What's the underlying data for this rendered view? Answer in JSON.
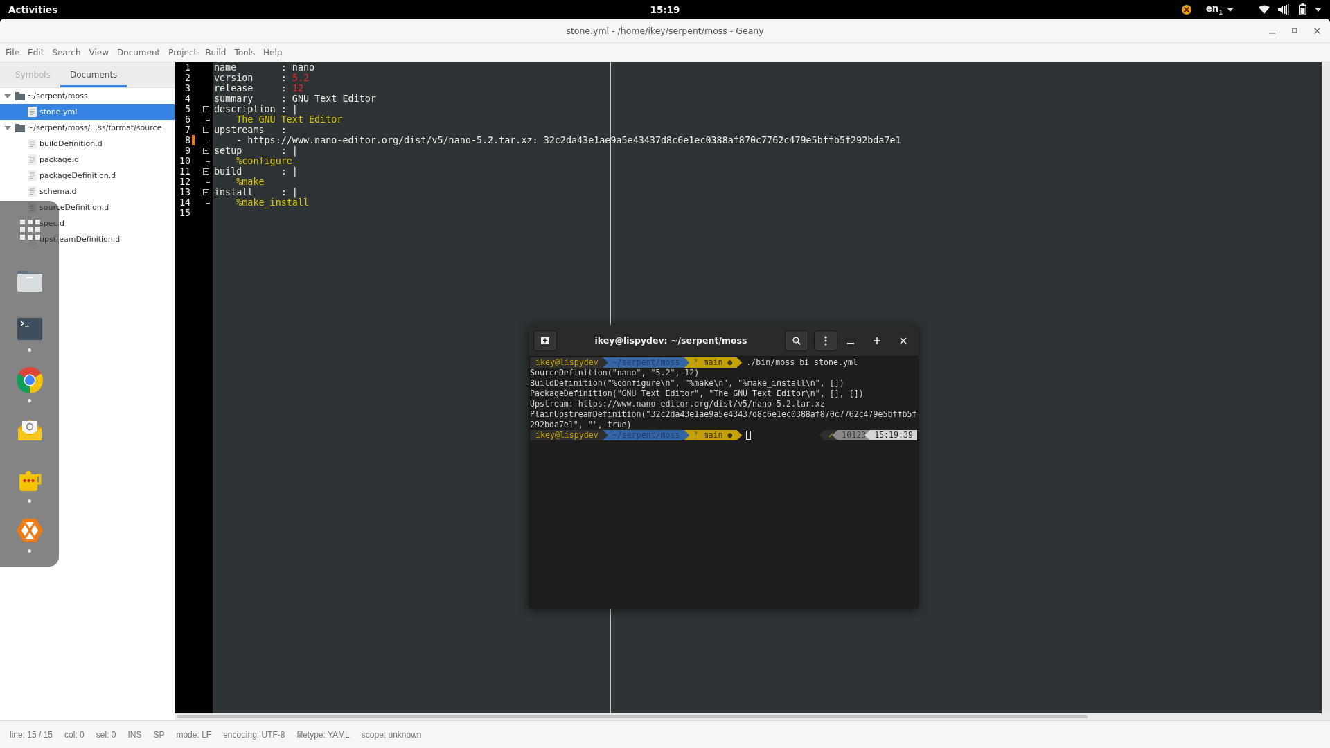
{
  "top_bar": {
    "activities": "Activities",
    "clock": "15:19",
    "keyboard": "en$_{1}$"
  },
  "window": {
    "title": "stone.yml - /home/ikey/serpent/moss - Geany"
  },
  "menu": [
    "File",
    "Edit",
    "Search",
    "View",
    "Document",
    "Project",
    "Build",
    "Tools",
    "Help"
  ],
  "sidebar": {
    "tabs": [
      {
        "label": "Symbols",
        "selected": false
      },
      {
        "label": "Documents",
        "selected": true
      }
    ],
    "tree": [
      {
        "kind": "folder",
        "label": "~/serpent/moss",
        "expanded": true,
        "selected": false,
        "children": [
          {
            "kind": "file",
            "label": "stone.yml",
            "selected": true
          }
        ]
      },
      {
        "kind": "folder",
        "label": "~/serpent/moss/…ss/format/source",
        "expanded": true,
        "selected": false,
        "children": [
          {
            "kind": "file",
            "label": "buildDefinition.d",
            "selected": false
          },
          {
            "kind": "file",
            "label": "package.d",
            "selected": false
          },
          {
            "kind": "file",
            "label": "packageDefinition.d",
            "selected": false
          },
          {
            "kind": "file",
            "label": "schema.d",
            "selected": false
          },
          {
            "kind": "file",
            "label": "sourceDefinition.d",
            "selected": false
          },
          {
            "kind": "file",
            "label": "spec.d",
            "selected": false
          },
          {
            "kind": "file",
            "label": "upstreamDefinition.d",
            "selected": false
          }
        ]
      }
    ]
  },
  "editor": {
    "lines": [
      {
        "number": "1",
        "fold_start": false,
        "fold_end": false,
        "modified": false,
        "tokens": [
          {
            "kind": "plain",
            "text": "name        : nano"
          }
        ]
      },
      {
        "number": "2",
        "fold_start": false,
        "fold_end": false,
        "modified": false,
        "tokens": [
          {
            "kind": "plain",
            "text": "version     : "
          },
          {
            "kind": "number",
            "text": "5.2"
          }
        ]
      },
      {
        "number": "3",
        "fold_start": false,
        "fold_end": false,
        "modified": false,
        "tokens": [
          {
            "kind": "plain",
            "text": "release     : "
          },
          {
            "kind": "number",
            "text": "12"
          }
        ]
      },
      {
        "number": "4",
        "fold_start": false,
        "fold_end": false,
        "modified": false,
        "tokens": [
          {
            "kind": "plain",
            "text": "summary     : GNU Text Editor"
          }
        ]
      },
      {
        "number": "5",
        "fold_start": true,
        "fold_end": false,
        "modified": false,
        "tokens": [
          {
            "kind": "plain",
            "text": "description : |"
          }
        ]
      },
      {
        "number": "6",
        "fold_start": false,
        "fold_end": true,
        "modified": false,
        "tokens": [
          {
            "kind": "string",
            "text": "    The GNU Text Editor"
          }
        ]
      },
      {
        "number": "7",
        "fold_start": true,
        "fold_end": false,
        "modified": false,
        "tokens": [
          {
            "kind": "plain",
            "text": "upstreams   :"
          }
        ]
      },
      {
        "number": "8",
        "fold_start": false,
        "fold_end": true,
        "modified": true,
        "tokens": [
          {
            "kind": "plain",
            "text": "    - https://www.nano-editor.org/dist/v5/nano-5.2.tar.xz: 32c2da43e1ae9a5e43437d8c6e1ec0388af870c7762c479e5bffb5f292bda7e1"
          }
        ]
      },
      {
        "number": "9",
        "fold_start": true,
        "fold_end": false,
        "modified": false,
        "tokens": [
          {
            "kind": "plain",
            "text": "setup       : |"
          }
        ]
      },
      {
        "number": "10",
        "fold_start": false,
        "fold_end": true,
        "modified": false,
        "tokens": [
          {
            "kind": "string",
            "text": "    %configure"
          }
        ]
      },
      {
        "number": "11",
        "fold_start": true,
        "fold_end": false,
        "modified": false,
        "tokens": [
          {
            "kind": "plain",
            "text": "build       : |"
          }
        ]
      },
      {
        "number": "12",
        "fold_start": false,
        "fold_end": true,
        "modified": false,
        "tokens": [
          {
            "kind": "string",
            "text": "    %make"
          }
        ]
      },
      {
        "number": "13",
        "fold_start": true,
        "fold_end": false,
        "modified": false,
        "tokens": [
          {
            "kind": "plain",
            "text": "install     : |"
          }
        ]
      },
      {
        "number": "14",
        "fold_start": false,
        "fold_end": true,
        "modified": false,
        "tokens": [
          {
            "kind": "string",
            "text": "    %make_install"
          }
        ]
      },
      {
        "number": "15",
        "fold_start": false,
        "fold_end": false,
        "modified": false
      }
    ]
  },
  "status_bar": [
    "line: 15 / 15",
    "col: 0",
    "sel: 0",
    "INS",
    "SP",
    "mode: LF",
    "encoding: UTF-8",
    "filetype: YAML",
    "scope: unknown"
  ],
  "dock": [
    {
      "kind": "apps",
      "running": false
    },
    {
      "kind": "files",
      "running": false
    },
    {
      "kind": "terminal",
      "running": true
    },
    {
      "kind": "browser",
      "running": true
    },
    {
      "kind": "mail",
      "running": false
    },
    {
      "kind": "jug",
      "running": true
    },
    {
      "kind": "hexagon",
      "running": true
    }
  ],
  "terminal": {
    "title": "ikey@lispydev: ~/serpent/moss",
    "lines": [
      {
        "kind": "prompt",
        "segments": [
          {
            "kind": "user",
            "text": "ikey@lispydev"
          },
          {
            "kind": "path",
            "text": "~/serpent/moss"
          },
          {
            "kind": "branch",
            "text": "ᚠ main ●"
          }
        ],
        "command": "./bin/moss bi stone.yml",
        "cursor": false
      },
      {
        "kind": "output",
        "text": "SourceDefinition(\"nano\", \"5.2\", 12)"
      },
      {
        "kind": "output",
        "text": "BuildDefinition(\"%configure\\n\", \"%make\\n\", \"%make_install\\n\", [])"
      },
      {
        "kind": "output",
        "text": "PackageDefinition(\"GNU Text Editor\", \"The GNU Text Editor\\n\", [], [])"
      },
      {
        "kind": "output",
        "text": "Upstream: https://www.nano-editor.org/dist/v5/nano-5.2.tar.xz"
      },
      {
        "kind": "output",
        "text": "PlainUpstreamDefinition(\"32c2da43e1ae9a5e43437d8c6e1ec0388af870c7762c479e5bffb5f"
      },
      {
        "kind": "output",
        "text": "292bda7e1\", \"\", true)"
      },
      {
        "kind": "prompt",
        "segments": [
          {
            "kind": "user",
            "text": "ikey@lispydev"
          },
          {
            "kind": "path",
            "text": "~/serpent/moss"
          },
          {
            "kind": "branch",
            "text": "ᚠ main ●"
          }
        ],
        "cursor": true,
        "right_segments": [
          {
            "kind": "status",
            "text": "✓"
          },
          {
            "kind": "count",
            "text": "10123"
          },
          {
            "kind": "time",
            "text": "15:19:39"
          }
        ]
      }
    ]
  }
}
